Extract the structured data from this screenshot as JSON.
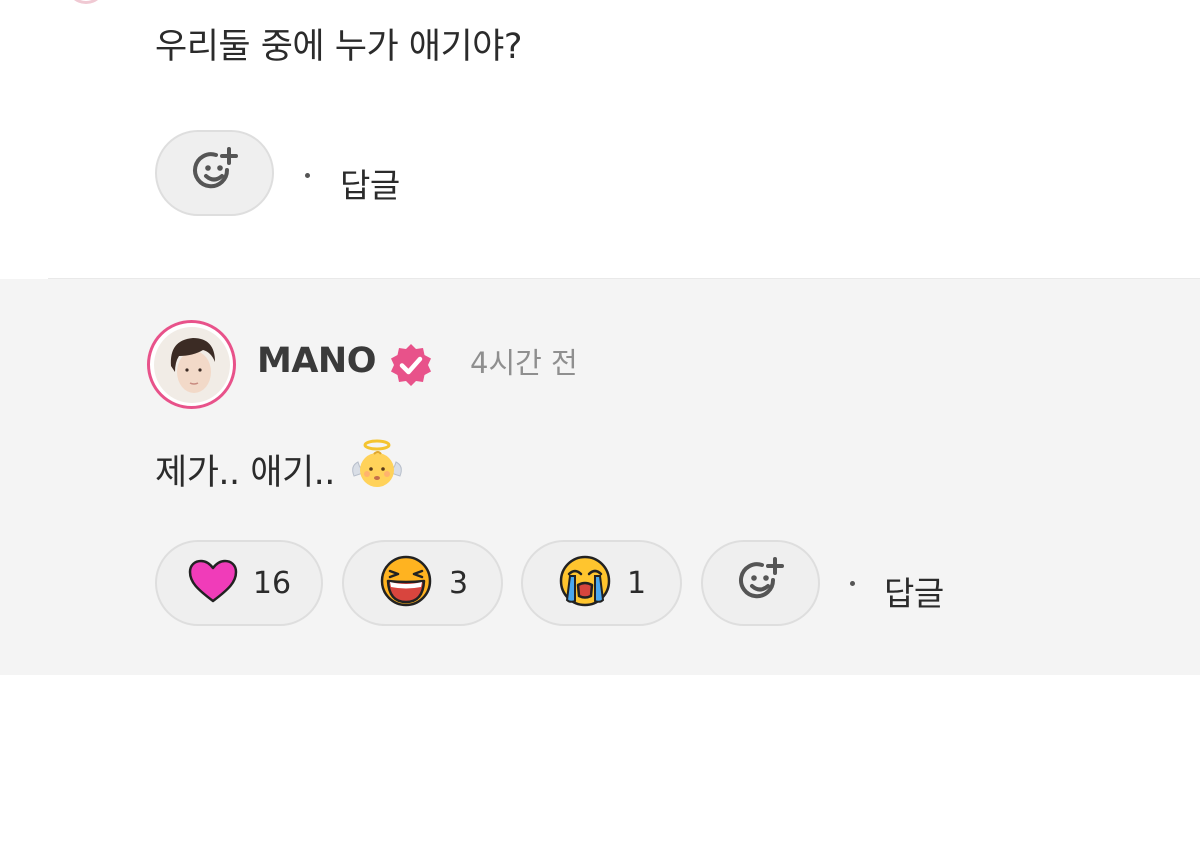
{
  "parent_comment": {
    "text": "우리둘 중에 누가 애기야?",
    "add_reaction_icon": "add-reaction-icon",
    "reply_label": "답글"
  },
  "reply": {
    "username": "MANO",
    "verified_icon": "verified-badge-icon",
    "accent_color": "#e8528a",
    "time": "4시간 전",
    "text": "제가.. 애기..",
    "text_emoji": "baby-angel-emoji",
    "reactions": [
      {
        "icon": "heart-icon",
        "count": "16"
      },
      {
        "icon": "laughing-face-icon",
        "count": "3"
      },
      {
        "icon": "crying-face-icon",
        "count": "1"
      }
    ],
    "add_reaction_icon": "add-reaction-icon",
    "reply_label": "답글"
  }
}
